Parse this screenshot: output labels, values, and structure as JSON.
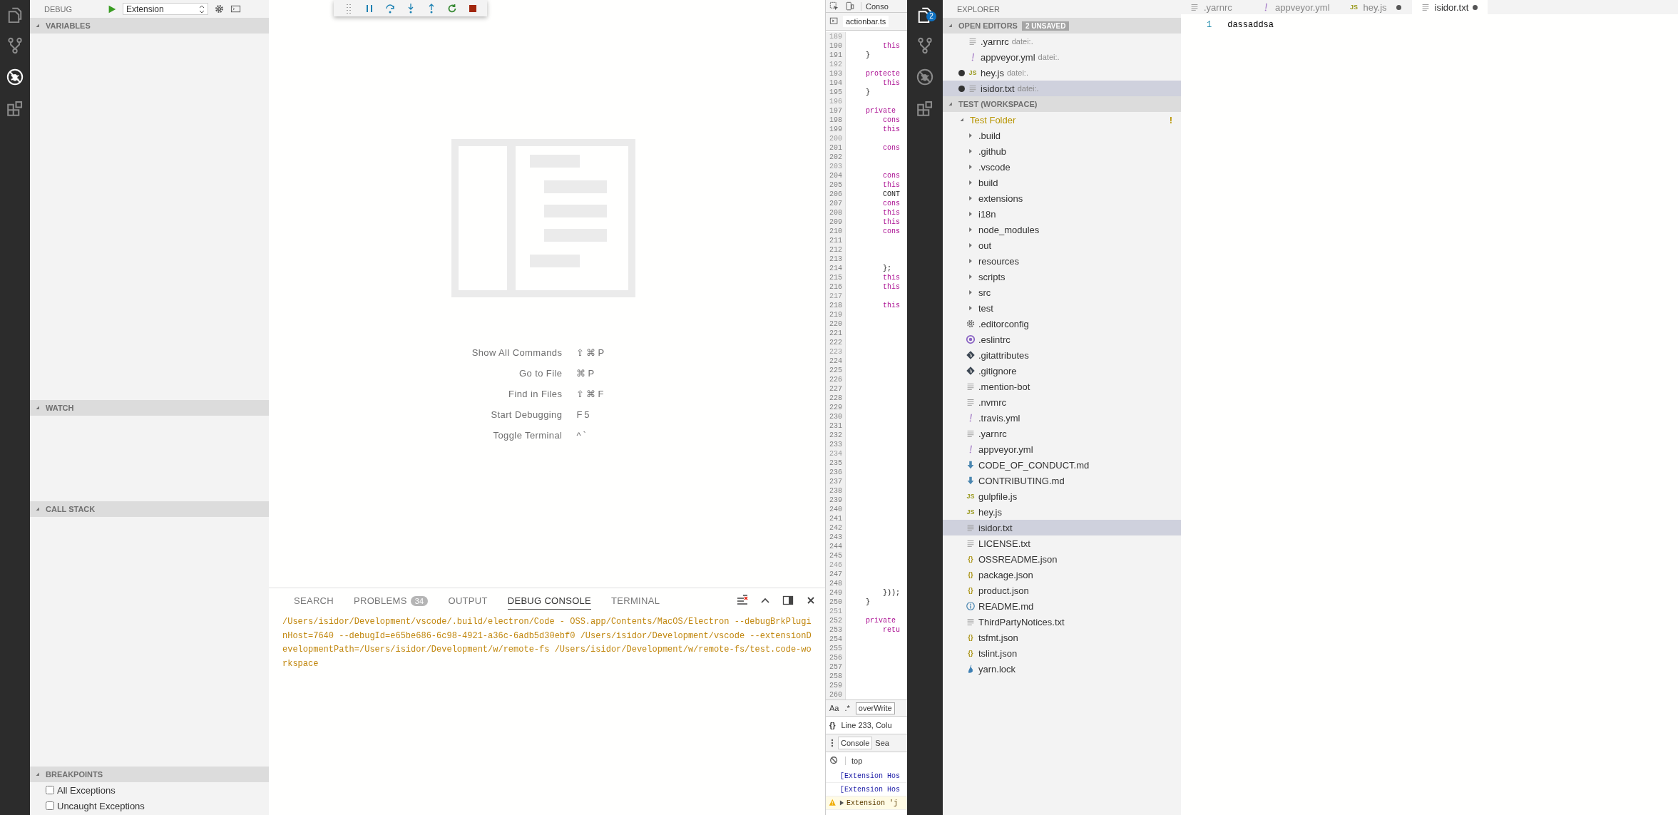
{
  "activity_bar_left": {
    "items": [
      {
        "kind": "files",
        "selected": false
      },
      {
        "kind": "git",
        "selected": false
      },
      {
        "kind": "debug",
        "selected": true
      },
      {
        "kind": "extensions",
        "selected": false
      }
    ]
  },
  "debug_sidebar": {
    "title": "DEBUG",
    "configuration": "Extension",
    "sections": [
      {
        "title": "VARIABLES",
        "expanded": true
      },
      {
        "title": "WATCH",
        "expanded": true
      },
      {
        "title": "CALL STACK",
        "expanded": true
      },
      {
        "title": "BREAKPOINTS",
        "expanded": true
      }
    ],
    "breakpoints": [
      {
        "label": "All Exceptions",
        "checked": false
      },
      {
        "label": "Uncaught Exceptions",
        "checked": false
      }
    ]
  },
  "debug_toolbar": {
    "buttons": [
      {
        "kind": "grip"
      },
      {
        "kind": "pause"
      },
      {
        "kind": "step-over"
      },
      {
        "kind": "step-into"
      },
      {
        "kind": "step-out"
      },
      {
        "kind": "restart"
      },
      {
        "kind": "stop"
      }
    ]
  },
  "welcome": {
    "commands": [
      {
        "label": "Show All Commands",
        "keys": "⇧⌘P"
      },
      {
        "label": "Go to File",
        "keys": "⌘P"
      },
      {
        "label": "Find in Files",
        "keys": "⇧⌘F"
      },
      {
        "label": "Start Debugging",
        "keys": "F5"
      },
      {
        "label": "Toggle Terminal",
        "keys": "^`"
      }
    ]
  },
  "panel": {
    "tabs": [
      {
        "label": "SEARCH",
        "selected": false
      },
      {
        "label": "PROBLEMS",
        "badge": "34",
        "selected": false
      },
      {
        "label": "OUTPUT",
        "selected": false
      },
      {
        "label": "DEBUG CONSOLE",
        "selected": true
      },
      {
        "label": "TERMINAL",
        "selected": false
      }
    ],
    "console_output": "/Users/isidor/Development/vscode/.build/electron/Code - OSS.app/Contents/MacOS/Electron --debugBrkPluginHost=7640 --debugId=e65be686-6c98-4921-a36c-6adb5d30ebf0 /Users/isidor/Development/vscode --extensionDevelopmentPath=/Users/isidor/Development/w/remote-fs /Users/isidor/Development/w/remote-fs/test.code-workspace"
  },
  "devtools": {
    "top_tab": "Conso",
    "file_tab": "actionbar.ts",
    "lines": [
      {
        "number": "189",
        "dim": true
      },
      {
        "number": "190",
        "dim": false,
        "code": "        this",
        "kind": "keyword"
      },
      {
        "number": "191",
        "dim": false,
        "code": "    }",
        "kind": "plain"
      },
      {
        "number": "192",
        "dim": true
      },
      {
        "number": "193",
        "dim": false,
        "code": "    protecte",
        "kind": "keyword"
      },
      {
        "number": "194",
        "dim": false,
        "code": "        this",
        "kind": "keyword"
      },
      {
        "number": "195",
        "dim": false,
        "code": "    }",
        "kind": "plain"
      },
      {
        "number": "196",
        "dim": true
      },
      {
        "number": "197",
        "dim": false,
        "code": "    private",
        "kind": "keyword"
      },
      {
        "number": "198",
        "dim": false,
        "code": "        cons",
        "kind": "keyword"
      },
      {
        "number": "199",
        "dim": false,
        "code": "        this",
        "kind": "keyword"
      },
      {
        "number": "200",
        "dim": true
      },
      {
        "number": "201",
        "dim": false,
        "code": "        cons",
        "kind": "keyword"
      },
      {
        "number": "202",
        "dim": false
      },
      {
        "number": "203",
        "dim": true
      },
      {
        "number": "204",
        "dim": false,
        "code": "        cons",
        "kind": "keyword"
      },
      {
        "number": "205",
        "dim": false,
        "code": "        this",
        "kind": "keyword"
      },
      {
        "number": "206",
        "dim": false,
        "code": "        CONT",
        "kind": "plain"
      },
      {
        "number": "207",
        "dim": false,
        "code": "        cons",
        "kind": "keyword"
      },
      {
        "number": "208",
        "dim": false,
        "code": "        this",
        "kind": "keyword"
      },
      {
        "number": "209",
        "dim": false,
        "code": "        this",
        "kind": "keyword"
      },
      {
        "number": "210",
        "dim": false,
        "code": "        cons",
        "kind": "keyword"
      },
      {
        "number": "211",
        "dim": false
      },
      {
        "number": "212",
        "dim": false
      },
      {
        "number": "213",
        "dim": false
      },
      {
        "number": "214",
        "dim": false,
        "code": "        };",
        "kind": "plain"
      },
      {
        "number": "215",
        "dim": false,
        "code": "        this",
        "kind": "keyword"
      },
      {
        "number": "216",
        "dim": false,
        "code": "        this",
        "kind": "keyword"
      },
      {
        "number": "217",
        "dim": true
      },
      {
        "number": "218",
        "dim": false,
        "code": "        this",
        "kind": "keyword"
      },
      {
        "number": "219",
        "dim": false
      },
      {
        "number": "220",
        "dim": false
      },
      {
        "number": "221",
        "dim": false
      },
      {
        "number": "222",
        "dim": false
      },
      {
        "number": "223",
        "dim": true
      },
      {
        "number": "224",
        "dim": false
      },
      {
        "number": "225",
        "dim": false
      },
      {
        "number": "226",
        "dim": false
      },
      {
        "number": "227",
        "dim": false
      },
      {
        "number": "228",
        "dim": false
      },
      {
        "number": "229",
        "dim": false
      },
      {
        "number": "230",
        "dim": false
      },
      {
        "number": "231",
        "dim": false
      },
      {
        "number": "232",
        "dim": false
      },
      {
        "number": "233",
        "dim": false
      },
      {
        "number": "234",
        "dim": true
      },
      {
        "number": "235",
        "dim": false
      },
      {
        "number": "236",
        "dim": false
      },
      {
        "number": "237",
        "dim": false
      },
      {
        "number": "238",
        "dim": false
      },
      {
        "number": "239",
        "dim": false
      },
      {
        "number": "240",
        "dim": false
      },
      {
        "number": "241",
        "dim": false
      },
      {
        "number": "242",
        "dim": false
      },
      {
        "number": "243",
        "dim": false
      },
      {
        "number": "244",
        "dim": false
      },
      {
        "number": "245",
        "dim": false
      },
      {
        "number": "246",
        "dim": true
      },
      {
        "number": "247",
        "dim": false
      },
      {
        "number": "248",
        "dim": false
      },
      {
        "number": "249",
        "dim": false,
        "code": "        }));",
        "kind": "plain"
      },
      {
        "number": "250",
        "dim": false,
        "code": "    }",
        "kind": "plain"
      },
      {
        "number": "251",
        "dim": true
      },
      {
        "number": "252",
        "dim": false,
        "code": "    private",
        "kind": "keyword"
      },
      {
        "number": "253",
        "dim": false,
        "code": "        retu",
        "kind": "keyword"
      },
      {
        "number": "254",
        "dim": false
      },
      {
        "number": "255",
        "dim": false
      },
      {
        "number": "256",
        "dim": false
      },
      {
        "number": "257",
        "dim": false
      },
      {
        "number": "258",
        "dim": false
      },
      {
        "number": "259",
        "dim": false
      },
      {
        "number": "260",
        "dim": false
      }
    ],
    "search": {
      "case_option": "Aa",
      "regex_option": ".*",
      "value": "overWrite"
    },
    "status": {
      "format_label": "{}",
      "position": "Line 233, Colu"
    },
    "drawer_tabs": [
      {
        "label": "Console",
        "selected": true
      },
      {
        "label": "Sea",
        "selected": false
      }
    ],
    "context": "top",
    "messages": [
      {
        "kind": "log",
        "text": "[Extension Hos"
      },
      {
        "kind": "log",
        "text": "[Extension Hos"
      },
      {
        "kind": "warning",
        "text": "Extension 'j"
      }
    ]
  },
  "activity_bar_right": {
    "items": [
      {
        "kind": "files",
        "selected": true,
        "badge": "2"
      },
      {
        "kind": "git",
        "selected": false
      },
      {
        "kind": "debug",
        "selected": false
      },
      {
        "kind": "extensions",
        "selected": false
      }
    ]
  },
  "explorer": {
    "title": "EXPLORER",
    "open_editors": {
      "title": "OPEN EDITORS",
      "badge": "2 UNSAVED",
      "expanded": true,
      "items": [
        {
          "name": ".yarnrc",
          "description": "datei:.",
          "kind": "text",
          "dirty": false,
          "selected": false
        },
        {
          "name": "appveyor.yml",
          "description": "datei:.",
          "kind": "yaml",
          "dirty": false,
          "selected": false
        },
        {
          "name": "hey.js",
          "description": "datei:.",
          "kind": "js",
          "icon_label": "JS",
          "dirty": true,
          "selected": false
        },
        {
          "name": "isidor.txt",
          "description": "datei:.",
          "kind": "text",
          "dirty": true,
          "selected": true
        }
      ]
    },
    "workspace": {
      "title": "TEST (WORKSPACE)",
      "expanded": true,
      "tree": [
        {
          "name": "Test Folder",
          "kind": "folder",
          "expanded": true,
          "selected": false,
          "decoration": "!",
          "children": [
            {
              "name": ".build",
              "kind": "folder",
              "expanded": false,
              "selected": false
            },
            {
              "name": ".github",
              "kind": "folder",
              "expanded": false,
              "selected": false
            },
            {
              "name": ".vscode",
              "kind": "folder",
              "expanded": false,
              "selected": false
            },
            {
              "name": "build",
              "kind": "folder",
              "expanded": false,
              "selected": false
            },
            {
              "name": "extensions",
              "kind": "folder",
              "expanded": false,
              "selected": false
            },
            {
              "name": "i18n",
              "kind": "folder",
              "expanded": false,
              "selected": false
            },
            {
              "name": "node_modules",
              "kind": "folder",
              "expanded": false,
              "selected": false
            },
            {
              "name": "out",
              "kind": "folder",
              "expanded": false,
              "selected": false
            },
            {
              "name": "resources",
              "kind": "folder",
              "expanded": false,
              "selected": false
            },
            {
              "name": "scripts",
              "kind": "folder",
              "expanded": false,
              "selected": false
            },
            {
              "name": "src",
              "kind": "folder",
              "expanded": false,
              "selected": false
            },
            {
              "name": "test",
              "kind": "folder",
              "expanded": false,
              "selected": false
            },
            {
              "name": ".editorconfig",
              "kind": "gear",
              "selected": false
            },
            {
              "name": ".eslintrc",
              "kind": "eslint",
              "selected": false
            },
            {
              "name": ".gitattributes",
              "kind": "git",
              "selected": false
            },
            {
              "name": ".gitignore",
              "kind": "git",
              "selected": false
            },
            {
              "name": ".mention-bot",
              "kind": "text",
              "selected": false
            },
            {
              "name": ".nvmrc",
              "kind": "text",
              "selected": false
            },
            {
              "name": ".travis.yml",
              "kind": "yaml",
              "selected": false
            },
            {
              "name": ".yarnrc",
              "kind": "text",
              "selected": false
            },
            {
              "name": "appveyor.yml",
              "kind": "yaml",
              "selected": false
            },
            {
              "name": "CODE_OF_CONDUCT.md",
              "kind": "markdown",
              "selected": false
            },
            {
              "name": "CONTRIBUTING.md",
              "kind": "markdown",
              "selected": false
            },
            {
              "name": "gulpfile.js",
              "kind": "js",
              "icon_label": "JS",
              "selected": false
            },
            {
              "name": "hey.js",
              "kind": "js",
              "icon_label": "JS",
              "selected": false
            },
            {
              "name": "isidor.txt",
              "kind": "text",
              "selected": true
            },
            {
              "name": "LICENSE.txt",
              "kind": "text",
              "selected": false
            },
            {
              "name": "OSSREADME.json",
              "kind": "json",
              "icon_label": "{}",
              "selected": false
            },
            {
              "name": "package.json",
              "kind": "json",
              "icon_label": "{}",
              "selected": false
            },
            {
              "name": "product.json",
              "kind": "json",
              "icon_label": "{}",
              "selected": false
            },
            {
              "name": "README.md",
              "kind": "info",
              "selected": false
            },
            {
              "name": "ThirdPartyNotices.txt",
              "kind": "text",
              "selected": false
            },
            {
              "name": "tsfmt.json",
              "kind": "json",
              "icon_label": "{}",
              "selected": false
            },
            {
              "name": "tslint.json",
              "kind": "json",
              "icon_label": "{}",
              "selected": false
            },
            {
              "name": "yarn.lock",
              "kind": "yarn",
              "selected": false
            }
          ]
        }
      ]
    }
  },
  "editor": {
    "tabs": [
      {
        "label": ".yarnrc",
        "kind": "text",
        "dirty": false,
        "selected": false
      },
      {
        "label": "appveyor.yml",
        "kind": "yaml",
        "dirty": false,
        "selected": false
      },
      {
        "label": "hey.js",
        "kind": "js",
        "icon_label": "JS",
        "dirty": true,
        "selected": false
      },
      {
        "label": "isidor.txt",
        "kind": "text",
        "dirty": true,
        "selected": true
      }
    ],
    "lines": [
      {
        "number": "1",
        "text": "dassaddsa"
      }
    ]
  }
}
